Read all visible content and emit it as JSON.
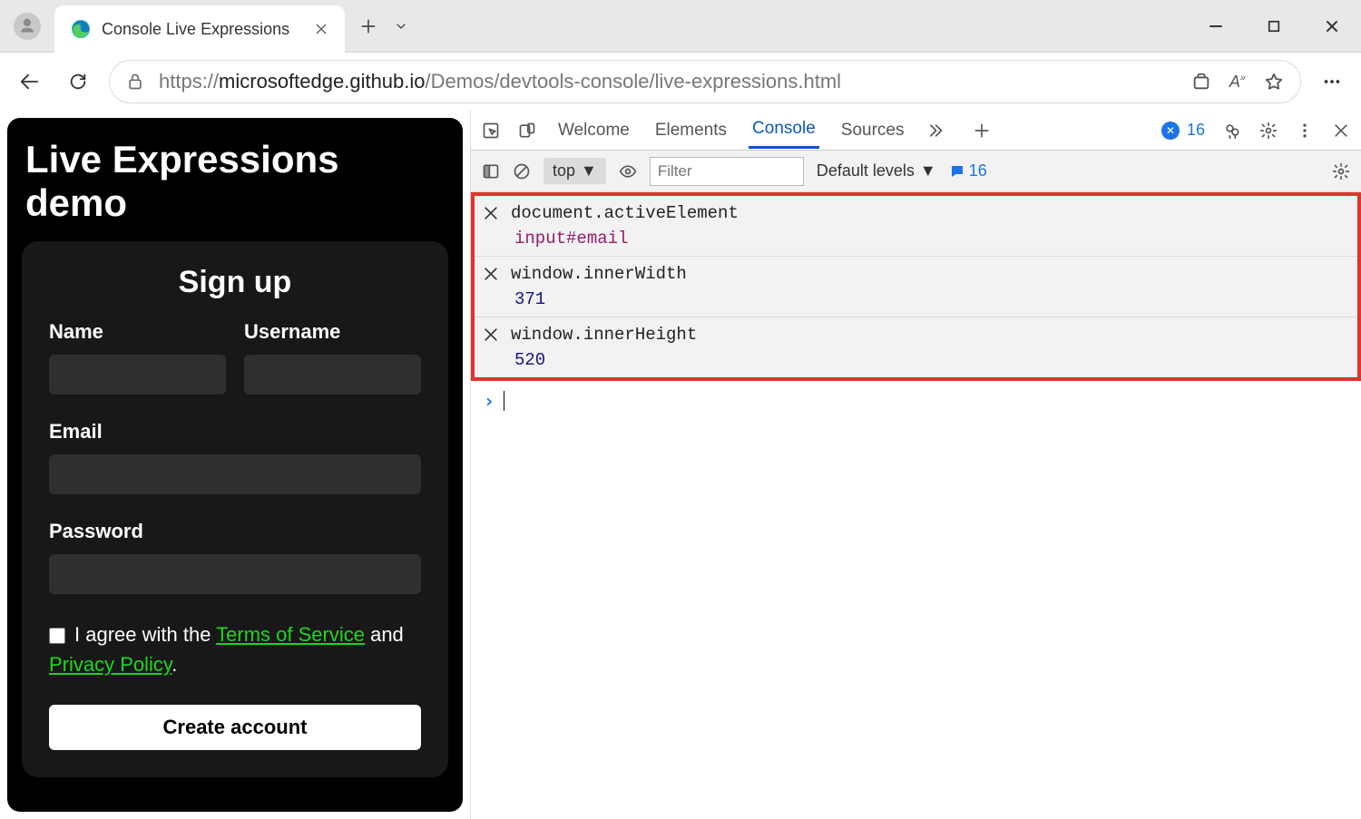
{
  "browser": {
    "tab_title": "Console Live Expressions",
    "url_proto": "https://",
    "url_host": "microsoftedge.github.io",
    "url_path": "/Demos/devtools-console/live-expressions.html"
  },
  "page": {
    "heading": "Live Expressions demo",
    "form_title": "Sign up",
    "name_label": "Name",
    "username_label": "Username",
    "email_label": "Email",
    "password_label": "Password",
    "agree_pre": "I agree with the ",
    "tos": "Terms of Service",
    "agree_mid": " and ",
    "privacy": "Privacy Policy",
    "agree_post": ".",
    "create_button": "Create account"
  },
  "devtools": {
    "tabs": {
      "welcome": "Welcome",
      "elements": "Elements",
      "console": "Console",
      "sources": "Sources"
    },
    "issue_count": "16",
    "context": "top",
    "filter_placeholder": "Filter",
    "levels_label": "Default levels",
    "sidebar_issue_count": "16",
    "live": [
      {
        "expr": "document.activeElement",
        "value": "input#email",
        "kind": "obj"
      },
      {
        "expr": "window.innerWidth",
        "value": "371",
        "kind": "num"
      },
      {
        "expr": "window.innerHeight",
        "value": "520",
        "kind": "num"
      }
    ]
  }
}
